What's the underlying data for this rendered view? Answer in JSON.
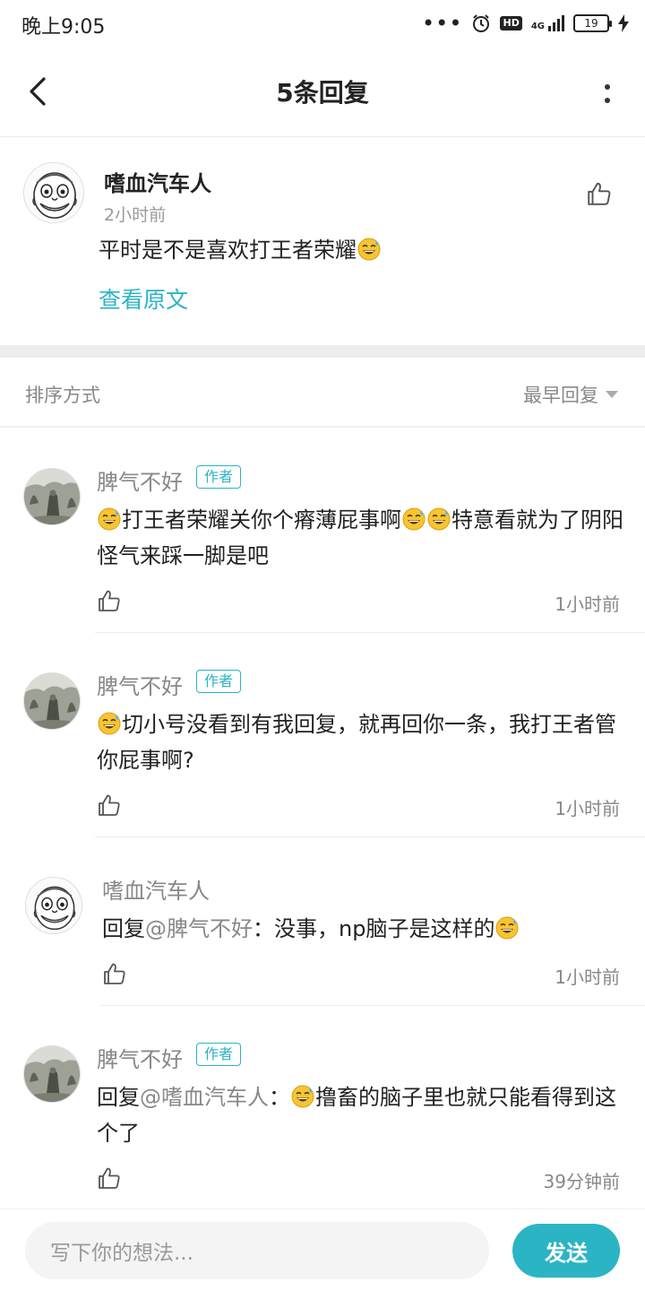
{
  "status_bar": {
    "time": "晚上9:05",
    "network": "4G",
    "battery": "19",
    "hd_label": "HD"
  },
  "nav": {
    "title": "5条回复"
  },
  "main_post": {
    "author": "嗜血汽车人",
    "time": "2小时前",
    "text": "平时是不是喜欢打王者荣耀",
    "view_original": "查看原文"
  },
  "sort": {
    "label": "排序方式",
    "value": "最早回复"
  },
  "replies": [
    {
      "author": "脾气不好",
      "tag": "作者",
      "text_a": "打王者荣耀关你个瘠薄屁事啊",
      "text_b": "特意看就为了阴阳怪气来踩一脚是吧",
      "time": "1小时前"
    },
    {
      "author": "脾气不好",
      "tag": "作者",
      "text_a": "切小号没看到有我回复，就再回你一条，我打王者管你屁事啊?",
      "time": "1小时前"
    },
    {
      "author": "嗜血汽车人",
      "reply_prefix": "回复",
      "reply_to": "@脾气不好",
      "text_a": "：没事，np脑子是这样的",
      "time": "1小时前"
    },
    {
      "author": "脾气不好",
      "tag": "作者",
      "reply_prefix": "回复",
      "reply_to": "@嗜血汽车人",
      "text_a": "：",
      "text_b": "撸畜的脑子里也就只能看得到这个了",
      "time": "39分钟前"
    }
  ],
  "input": {
    "placeholder": "写下你的想法...",
    "send_label": "发送"
  },
  "colors": {
    "accent": "#2bb4c4",
    "muted": "#888888"
  }
}
